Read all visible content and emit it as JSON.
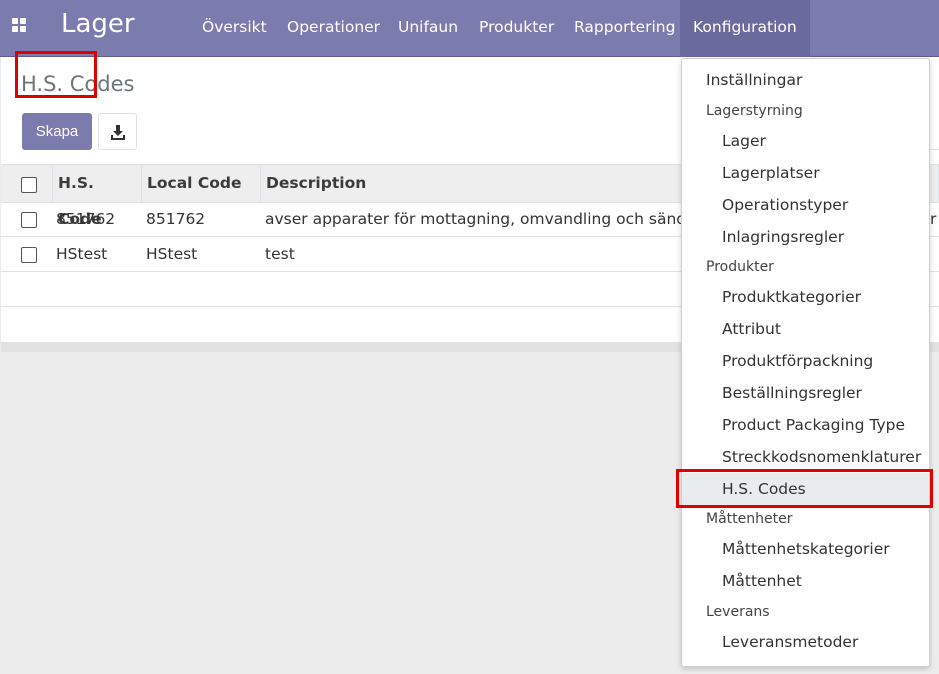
{
  "navbar": {
    "brand": "Lager",
    "menu": [
      "Översikt",
      "Operationer",
      "Unifaun",
      "Produkter",
      "Rapportering",
      "Konfiguration"
    ]
  },
  "control": {
    "title": "H.S. Codes",
    "create_label": "Skapa"
  },
  "table": {
    "columns": [
      "H.S. Code",
      "Local Code",
      "Description"
    ],
    "rows": [
      {
        "hs_code": "851762",
        "local_code": "851762",
        "description": "avser apparater för mottagning, omvandling och sändning",
        "overflow": "r"
      },
      {
        "hs_code": "HStest",
        "local_code": "HStest",
        "description": "test",
        "overflow": ""
      }
    ]
  },
  "dropdown": {
    "installningar": "Inställningar",
    "lagerstyrning": "Lagerstyrning",
    "lager": "Lager",
    "lagerplatser": "Lagerplatser",
    "operationstyper": "Operationstyper",
    "inlagringsregler": "Inlagringsregler",
    "produkter": "Produkter",
    "produktkategorier": "Produktkategorier",
    "attribut": "Attribut",
    "produktforpackning": "Produktförpackning",
    "bestallningsregler": "Beställningsregler",
    "product_packaging_type": "Product Packaging Type",
    "streckkodsnomenklaturer": "Streckkodsnomenklaturer",
    "hs_codes": "H.S. Codes",
    "mattenheter": "Måttenheter",
    "mattenhetskategorier": "Måttenhetskategorier",
    "mattenhet": "Måttenhet",
    "leverans": "Leverans",
    "leveransmetoder": "Leveransmetoder"
  },
  "colors": {
    "navbar": "#7c7bad",
    "highlight": "#e00000"
  },
  "icons": [
    "apps-grid-icon",
    "download-icon"
  ]
}
